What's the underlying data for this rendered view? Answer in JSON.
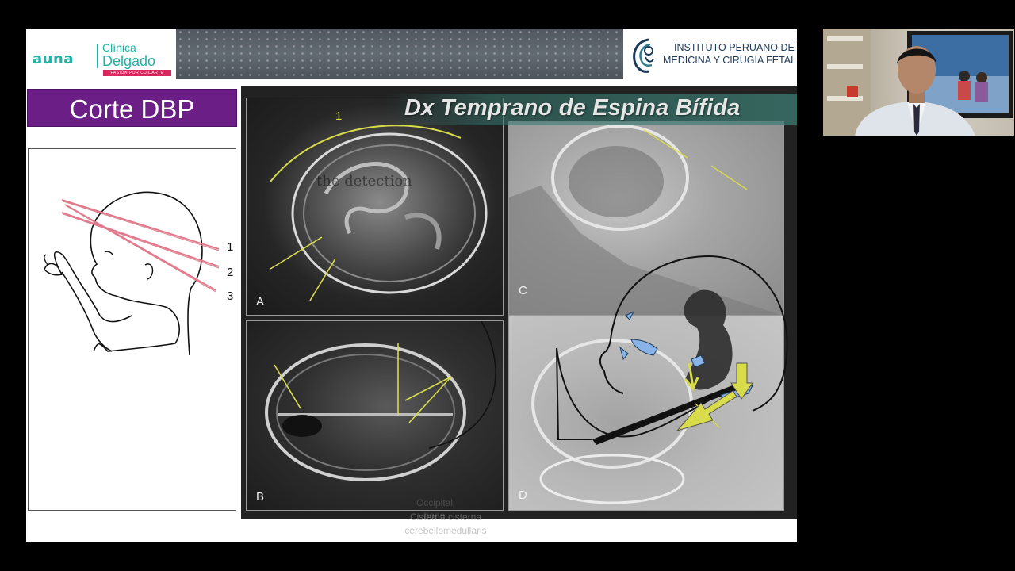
{
  "header": {
    "brand_left": "auna",
    "clinic_line1": "Clínica",
    "clinic_line2": "Delgado",
    "clinic_tagline": "PASIÓN POR CUIDARTE",
    "institute_line1": "INSTITUTO PERUANO DE",
    "institute_line2": "MEDICINA Y CIRUGIA FETAL"
  },
  "left_panel": {
    "title": "Corte DBP",
    "plane_labels": [
      "1",
      "2",
      "3"
    ]
  },
  "ultrasound": {
    "banner": "Dx Temprano de Espina Bífida",
    "panel_letters": [
      "A",
      "B",
      "C",
      "D"
    ],
    "panel_a_marker": "1",
    "ghost_text_detection": "the detection",
    "ghost_text_occipital_1": "Occipital",
    "ghost_text_occipital_2": "bone",
    "below_text_1": "Cisterna cisterna",
    "below_text_2": "cerebellomedullaris"
  },
  "colors": {
    "title_purple": "#6b1f86",
    "brand_teal": "#1fb3a6",
    "institute_navy": "#1c3a5a",
    "annotation_yellow": "#d8dc4a",
    "annotation_blue": "#8ab4e8"
  }
}
